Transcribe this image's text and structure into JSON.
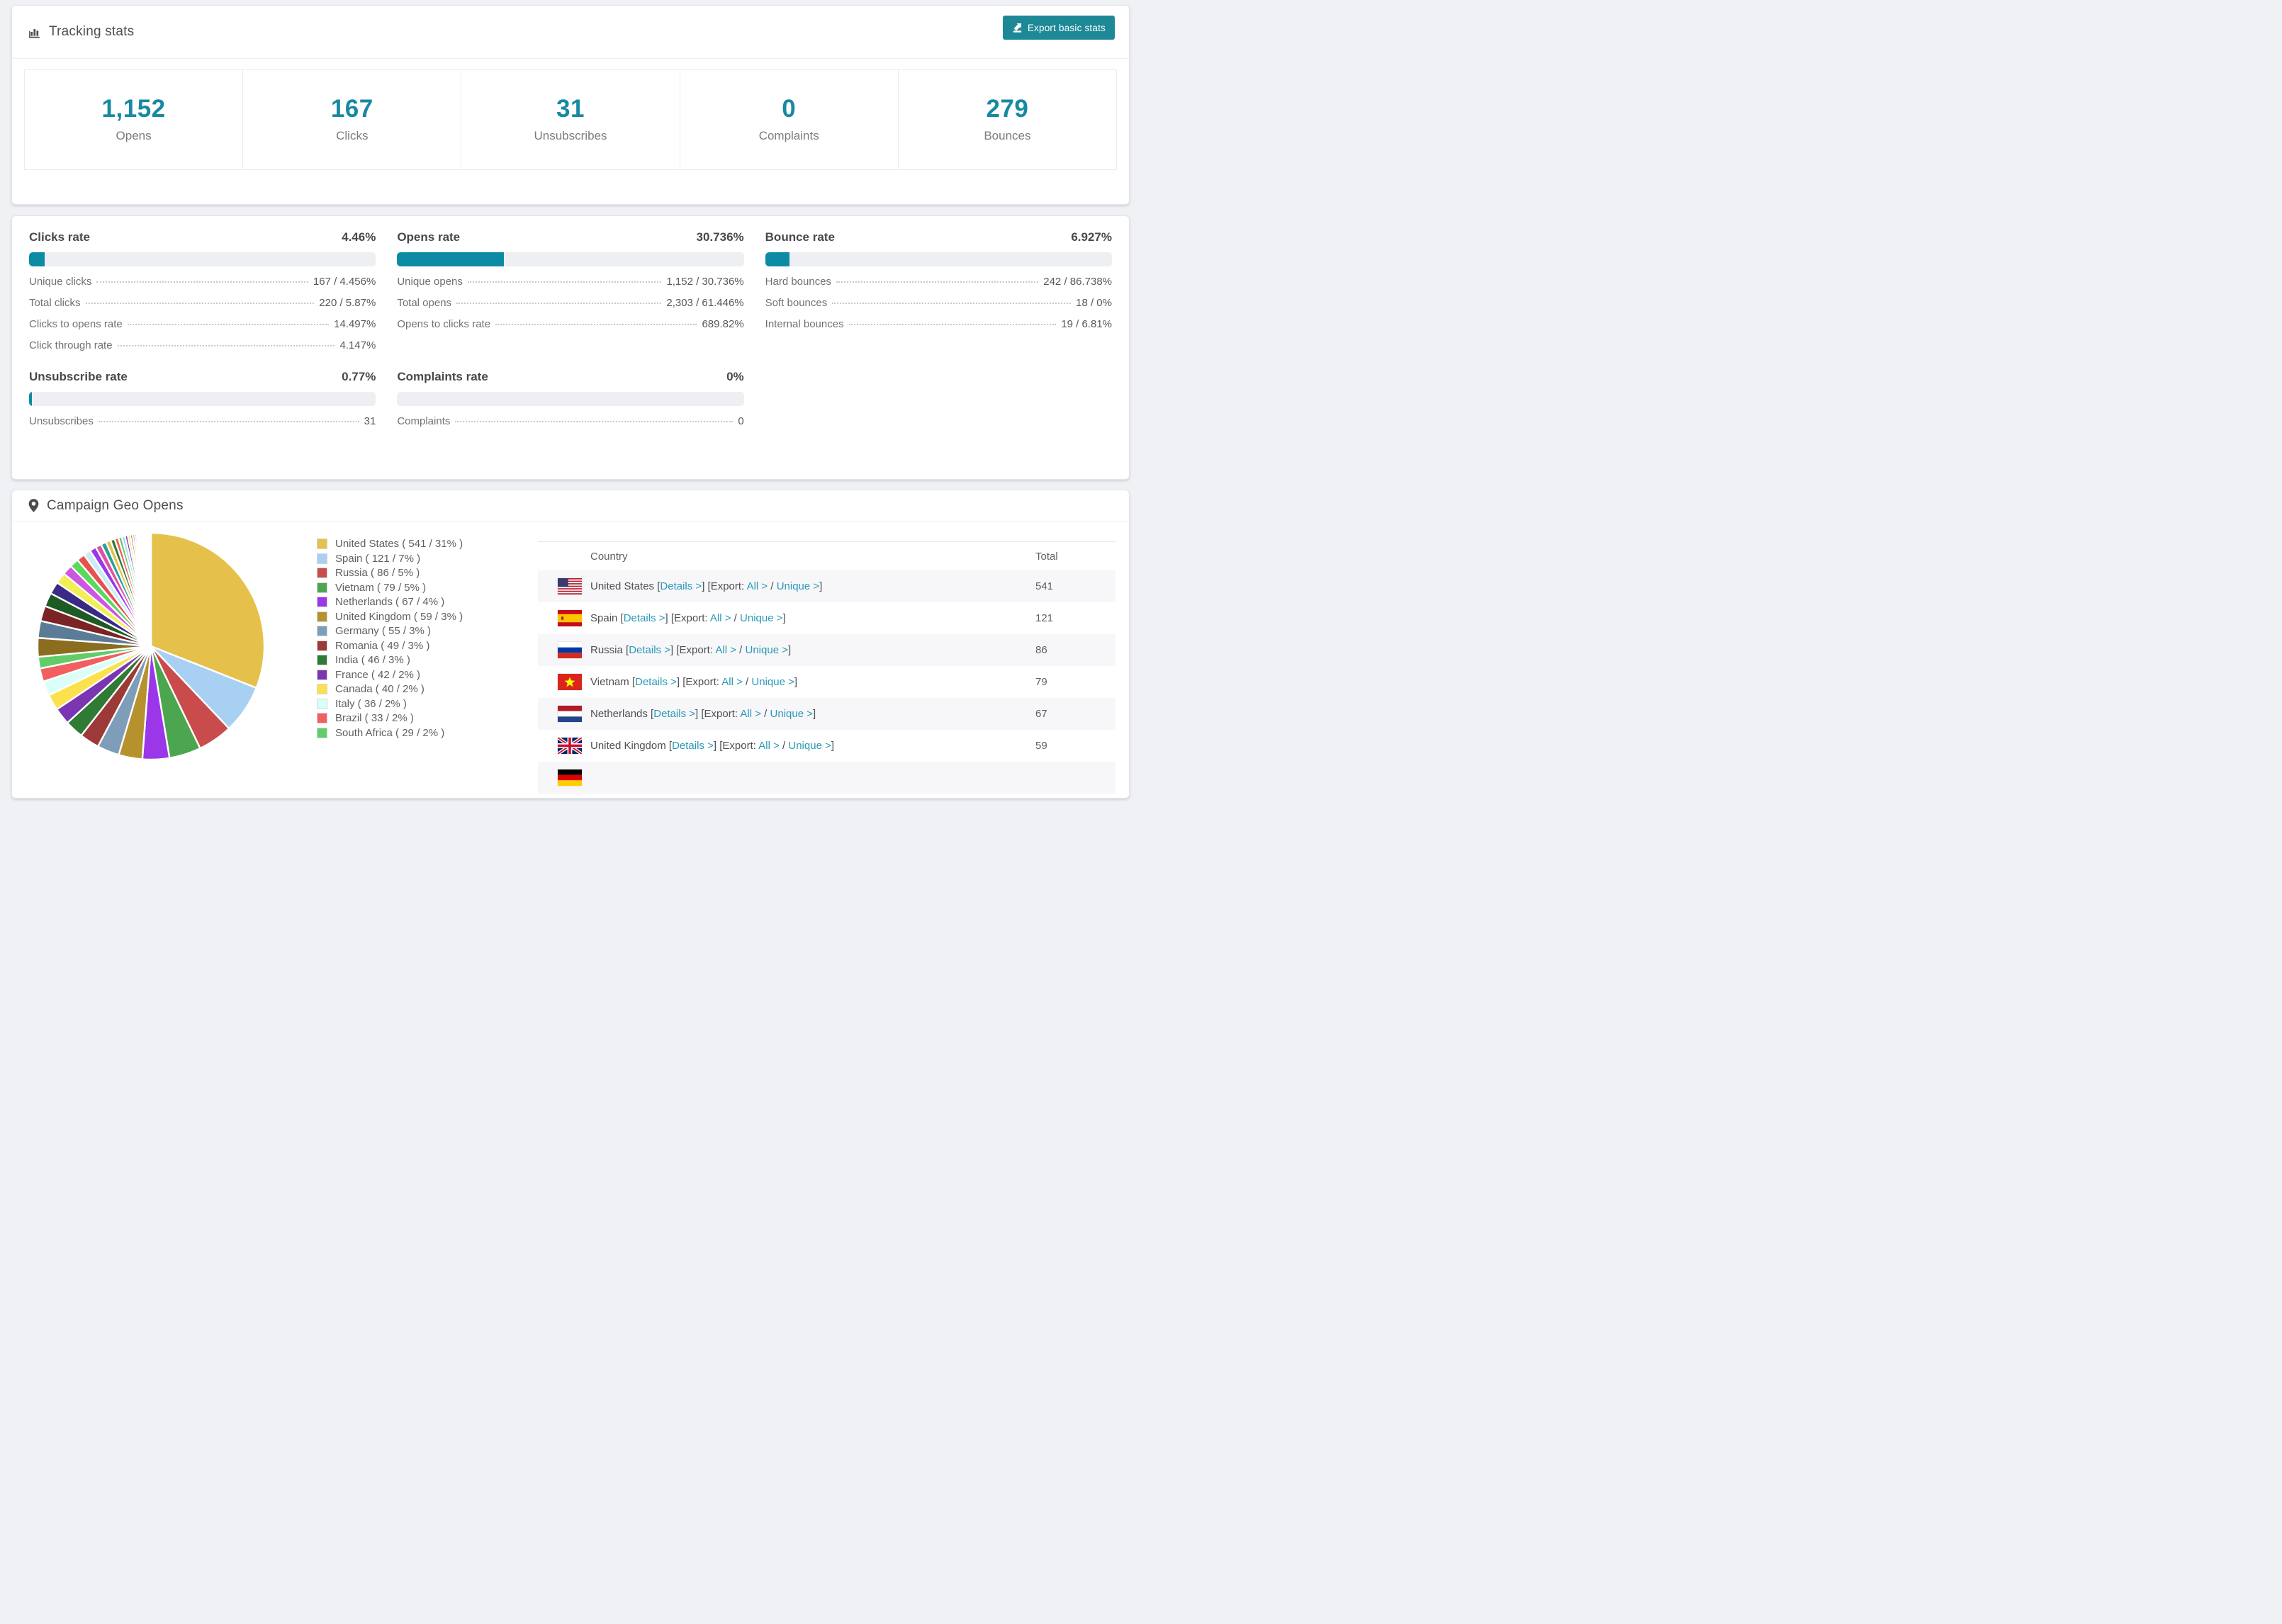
{
  "colors": {
    "accent_teal": "#0d8ba4",
    "stat_number": "#1789a3",
    "export_button_bg": "#1d8896",
    "link": "#2a9ab6",
    "bar_track": "#edeff2",
    "page_bg": "#f0f1f4"
  },
  "tracking": {
    "title": "Tracking stats",
    "export_button": "Export basic stats",
    "stats": [
      {
        "value": "1,152",
        "label": "Opens"
      },
      {
        "value": "167",
        "label": "Clicks"
      },
      {
        "value": "31",
        "label": "Unsubscribes"
      },
      {
        "value": "0",
        "label": "Complaints"
      },
      {
        "value": "279",
        "label": "Bounces"
      }
    ]
  },
  "rates": {
    "sections": [
      {
        "title": "Clicks rate",
        "display": "4.46%",
        "percent": 4.46,
        "rows": [
          {
            "label": "Unique clicks",
            "value": "167 / 4.456%"
          },
          {
            "label": "Total clicks",
            "value": "220 / 5.87%"
          },
          {
            "label": "Clicks to opens rate",
            "value": "14.497%"
          },
          {
            "label": "Click through rate",
            "value": "4.147%"
          }
        ]
      },
      {
        "title": "Opens rate",
        "display": "30.736%",
        "percent": 30.736,
        "rows": [
          {
            "label": "Unique opens",
            "value": "1,152 / 30.736%"
          },
          {
            "label": "Total opens",
            "value": "2,303 / 61.446%"
          },
          {
            "label": "Opens to clicks rate",
            "value": "689.82%"
          }
        ]
      },
      {
        "title": "Bounce rate",
        "display": "6.927%",
        "percent": 6.927,
        "rows": [
          {
            "label": "Hard bounces",
            "value": "242 / 86.738%"
          },
          {
            "label": "Soft bounces",
            "value": "18 / 0%"
          },
          {
            "label": "Internal bounces",
            "value": "19 / 6.81%"
          }
        ]
      },
      {
        "title": "Unsubscribe rate",
        "display": "0.77%",
        "percent": 0.77,
        "rows": [
          {
            "label": "Unsubscribes",
            "value": "31"
          }
        ]
      },
      {
        "title": "Complaints rate",
        "display": "0%",
        "percent": 0,
        "rows": [
          {
            "label": "Complaints",
            "value": "0"
          }
        ]
      }
    ]
  },
  "geo": {
    "title": "Campaign Geo Opens",
    "table": {
      "country_header": "Country",
      "total_header": "Total",
      "link_labels": {
        "details": "Details >",
        "export_prefix": "Export:",
        "all": "All >",
        "unique": "Unique >"
      },
      "rows": [
        {
          "country": "United States",
          "flag": "us",
          "total": "541"
        },
        {
          "country": "Spain",
          "flag": "es",
          "total": "121"
        },
        {
          "country": "Russia",
          "flag": "ru",
          "total": "86"
        },
        {
          "country": "Vietnam",
          "flag": "vn",
          "total": "79"
        },
        {
          "country": "Netherlands",
          "flag": "nl",
          "total": "67"
        },
        {
          "country": "United Kingdom",
          "flag": "gb",
          "total": "59"
        },
        {
          "country": "",
          "flag": "de",
          "total": "",
          "partial": true
        }
      ]
    }
  },
  "chart_data": {
    "type": "pie",
    "title": "Campaign Geo Opens",
    "legend_position": "right",
    "start_angle_deg": -90,
    "direction": "clockwise",
    "series": [
      {
        "name": "United States",
        "value": 541,
        "pct": 31,
        "color": "#e5c04b"
      },
      {
        "name": "Spain",
        "value": 121,
        "pct": 7,
        "color": "#a8d0f3"
      },
      {
        "name": "Russia",
        "value": 86,
        "pct": 5,
        "color": "#c94b4b"
      },
      {
        "name": "Vietnam",
        "value": 79,
        "pct": 5,
        "color": "#4ca64f"
      },
      {
        "name": "Netherlands",
        "value": 67,
        "pct": 4,
        "color": "#9b36e9"
      },
      {
        "name": "United Kingdom",
        "value": 59,
        "pct": 3,
        "color": "#b6922f"
      },
      {
        "name": "Germany",
        "value": 55,
        "pct": 3,
        "color": "#7e9db9"
      },
      {
        "name": "Romania",
        "value": 49,
        "pct": 3,
        "color": "#9c3a38"
      },
      {
        "name": "India",
        "value": 46,
        "pct": 3,
        "color": "#2f7a35"
      },
      {
        "name": "France",
        "value": 42,
        "pct": 2,
        "color": "#7b35b3"
      },
      {
        "name": "Canada",
        "value": 40,
        "pct": 2,
        "color": "#fce14e"
      },
      {
        "name": "Italy",
        "value": 36,
        "pct": 2,
        "color": "#dcfef8"
      },
      {
        "name": "Brazil",
        "value": 33,
        "pct": 2,
        "color": "#f15f5f"
      },
      {
        "name": "South Africa",
        "value": 29,
        "pct": 2,
        "color": "#62cd68"
      }
    ],
    "others": {
      "combined_share_pct": 26.5,
      "note": "long tail of small unlabeled countries shown as thin slices"
    },
    "filler_colors": [
      "#8a6d1f",
      "#5b7b96",
      "#7a2423",
      "#1e5b24",
      "#3a2a86",
      "#f2ef52",
      "#cf56e0",
      "#5bd85e",
      "#e85050",
      "#c9ecf7",
      "#9b36e9",
      "#e44f9e",
      "#2aa198",
      "#e5c04b",
      "#2f7a35",
      "#f15f5f",
      "#62cd68",
      "#a8d0f3",
      "#7b35b3",
      "#fce14e"
    ]
  }
}
